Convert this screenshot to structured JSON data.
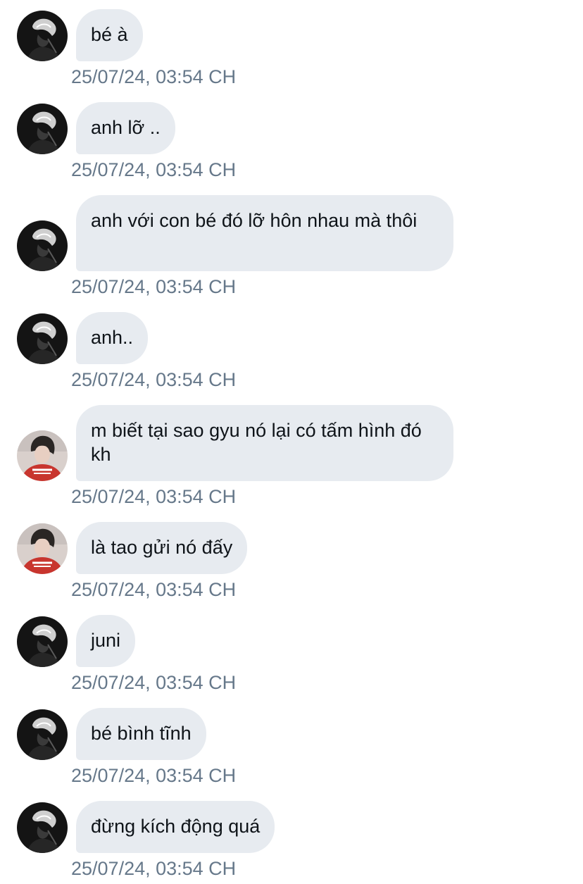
{
  "messages": [
    {
      "sender": "dark",
      "text": "bé à",
      "time": "25/07/24, 03:54 CH"
    },
    {
      "sender": "dark",
      "text": "anh lỡ ..",
      "time": "25/07/24, 03:54 CH"
    },
    {
      "sender": "dark",
      "text": "anh với con bé đó lỡ hôn nhau mà thôi",
      "time": "25/07/24, 03:54 CH"
    },
    {
      "sender": "dark",
      "text": "anh..",
      "time": "25/07/24, 03:54 CH"
    },
    {
      "sender": "red",
      "text": "m biết tại sao gyu nó lại có tấm hình đó kh",
      "time": "25/07/24, 03:54 CH"
    },
    {
      "sender": "red",
      "text": "là tao gửi nó đấy",
      "time": "25/07/24, 03:54 CH"
    },
    {
      "sender": "dark",
      "text": "juni",
      "time": "25/07/24, 03:54 CH"
    },
    {
      "sender": "dark",
      "text": "bé bình tĩnh",
      "time": "25/07/24, 03:54 CH"
    },
    {
      "sender": "dark",
      "text": "đừng kích động quá",
      "time": "25/07/24, 03:54 CH"
    }
  ],
  "colors": {
    "bubble": "#e7ebf0",
    "text": "#0f1419",
    "timestamp": "#66788a"
  }
}
